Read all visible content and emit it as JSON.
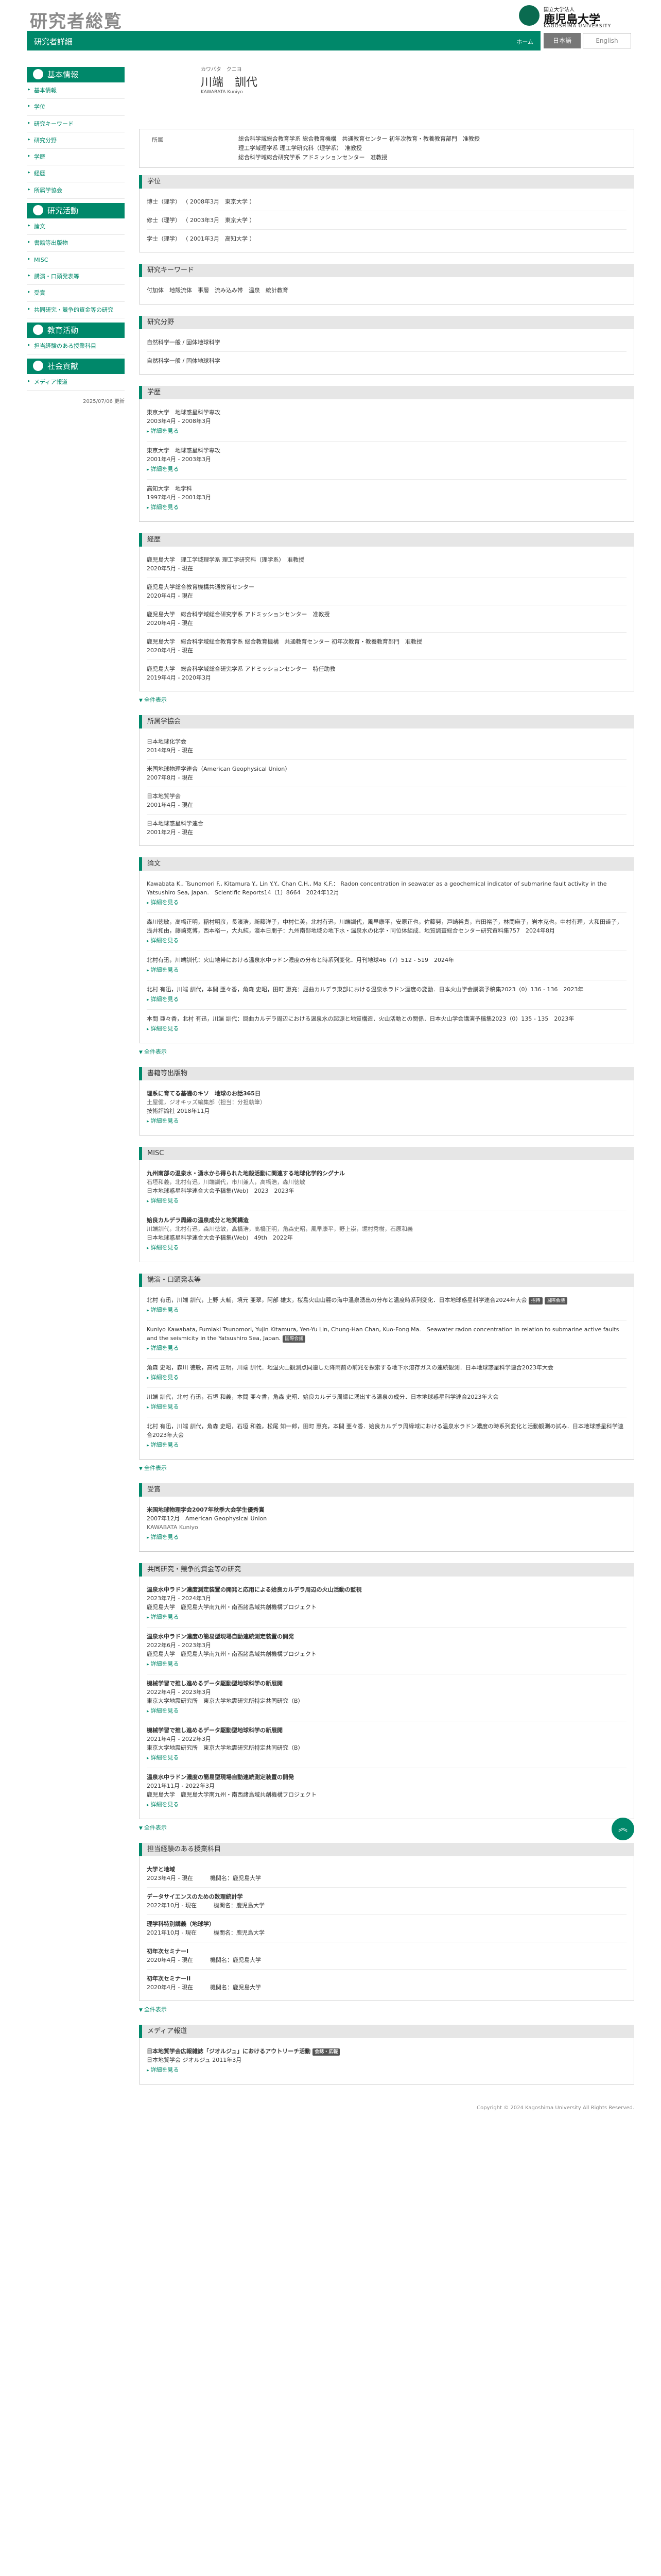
{
  "header": {
    "site_title": "研究者総覧",
    "subbar_label": "研究者詳細",
    "home_link": "ホーム",
    "lang_ja": "日本語",
    "lang_en": "English",
    "logo_sub": "国立大学法人",
    "logo_name": "鹿児島大学",
    "logo_en": "KAGOSHIMA UNIVERSITY"
  },
  "sidebar": {
    "basic_head": "基本情報",
    "basic_items": [
      "基本情報",
      "学位",
      "研究キーワード",
      "研究分野",
      "学歴",
      "経歴",
      "所属学協会"
    ],
    "research_head": "研究活動",
    "research_items": [
      "論文",
      "書籍等出版物",
      "MISC",
      "講演・口頭発表等",
      "受賞",
      "共同研究・競争的資金等の研究"
    ],
    "education_head": "教育活動",
    "education_items": [
      "担当経験のある授業科目"
    ],
    "social_head": "社会貢献",
    "social_items": [
      "メディア報道"
    ],
    "date": "2025/07/06 更新"
  },
  "profile": {
    "kana": "カワバタ　クニヨ",
    "name": "川端　訓代",
    "romaji": "KAWABATA Kuniyo",
    "aff_label": "所属",
    "aff_lines": [
      "総合科学域総合教育学系 総合教育機構　共通教育センター 初年次教育・教養教育部門　准教授",
      "理工学域理学系 理工学研究科（理学系）　准教授",
      "総合科学域総合研究学系 アドミッションセンター　准教授"
    ]
  },
  "degrees": {
    "head": "学位",
    "items": [
      "博士（理学） （ 2008年3月　東京大学 ）",
      "修士（理学） （ 2003年3月　東京大学 ）",
      "学士（理学） （ 2001年3月　高知大学 ）"
    ]
  },
  "keywords": {
    "head": "研究キーワード",
    "text": "付加体　地殻流体　事層　流み込み帯　温泉　統計教育"
  },
  "fields": {
    "head": "研究分野",
    "items": [
      "自然科学一般 / 固体地球科学",
      "自然科学一般 / 固体地球科学"
    ]
  },
  "education": {
    "head": "学歴",
    "more": "詳細を見る",
    "items": [
      {
        "name": "東京大学　地球惑星科学専攻",
        "date": "2003年4月 - 2008年3月"
      },
      {
        "name": "東京大学　地球惑星科学専攻",
        "date": "2001年4月 - 2003年3月"
      },
      {
        "name": "高知大学　地学科",
        "date": "1997年4月 - 2001年3月"
      }
    ]
  },
  "career": {
    "head": "経歴",
    "showall": "全件表示",
    "items": [
      {
        "name": "鹿児島大学　理工学域理学系 理工学研究科（理学系）　准教授",
        "date": "2020年5月 - 現在"
      },
      {
        "name": "鹿児島大学総合教育機構共通教育センター",
        "date": "2020年4月 - 現在"
      },
      {
        "name": "鹿児島大学　総合科学域総合研究学系 アドミッションセンター　准教授",
        "date": "2020年4月 - 現在"
      },
      {
        "name": "鹿児島大学　総合科学域総合教育学系 総合教育機構　共通教育センター 初年次教育・教養教育部門　准教授",
        "date": "2020年4月 - 現在"
      },
      {
        "name": "鹿児島大学　総合科学域総合研究学系 アドミッションセンター　特任助教",
        "date": "2019年4月 - 2020年3月"
      }
    ]
  },
  "societies": {
    "head": "所属学協会",
    "items": [
      {
        "name": "日本地球化学会",
        "date": "2014年9月 - 現在"
      },
      {
        "name": "米国地球物理学連合（American Geophysical Union）",
        "date": "2007年8月 - 現在"
      },
      {
        "name": "日本地質学会",
        "date": "2001年4月 - 現在"
      },
      {
        "name": "日本地球惑星科学連合",
        "date": "2001年2月 - 現在"
      }
    ]
  },
  "papers": {
    "head": "論文",
    "more": "詳細を見る",
    "showall": "全件表示",
    "items": [
      {
        "text": "Kawabata K., Tsunomori F., Kitamura Y., Lin Y.Y., Chan C.H., Ma K.F.： Radon concentration in seawater as a geochemical indicator of submarine fault activity in the Yatsushiro Sea, Japan.　Scientific Reports14（1）8664　2024年12月"
      },
      {
        "text": "森川徳敏，高橋正明，稲村明彦，長濱浩，新藤洋子，中村仁美，北村有迅，川端訓代，風早康平，安原正也，佐藤努，戸崎裕貴，市田裕子，林間麻子，岩本克也，中村有理，大和田道子，浅井和由，藤崎克博，西本裕一，大丸純，濱本日朋子：九州南部地域の地下水・温泉水の化学・同位体組成．地質調査総合センター研究資料集757　2024年8月"
      },
      {
        "text": "北村有迅，川端訓代：火山地帯における温泉水中ラドン濃度の分布と時系列変化．月刊地球46（7）512 - 519　2024年"
      },
      {
        "text": "北村 有迅，川端 訓代，本間 亜々香，角森 史昭，田町 惠充：屈曲カルデラ東部における温泉水ラドン濃度の変動．日本火山学会講演予稿集2023（0）136 - 136　2023年"
      },
      {
        "text": "本間 亜々香，北村 有迅，川端 訓代：屈曲カルデラ周辺における温泉水の起源と地質構造．火山活動との関係．日本火山学会講演予稿集2023（0）135 - 135　2023年"
      }
    ]
  },
  "books": {
    "head": "書籍等出版物",
    "more": "詳細を見る",
    "items": [
      {
        "title": "理系に育てる基礎のキソ　地球のお話365日",
        "auth": "土屋健，ジオキッズ編集部（担当：分担執筆）",
        "date": "技術評論社 2018年11月"
      }
    ]
  },
  "misc": {
    "head": "MISC",
    "more": "詳細を見る",
    "items": [
      {
        "title": "九州南部の温泉水・湧水から得られた地殻活動に関連する地球化学的シグナル",
        "auth": "石垣和義，北村有迅，川端訓代，市川兼人，高橋浩，森川徳敏",
        "date": "日本地球惑星科学連合大会予稿集(Web)　2023　2023年"
      },
      {
        "title": "姶良カルデラ周縁の温泉成分と地質構造",
        "auth": "川端訓代，北村有迅，森川徳敏，高橋浩，高橋正明，角森史昭，風早康平，野上崇，堀村秀樹，石原和義",
        "date": "日本地球惑星科学連合大会予稿集(Web)　49th　2022年"
      }
    ]
  },
  "talks": {
    "head": "講演・口頭発表等",
    "more": "詳細を見る",
    "showall": "全件表示",
    "badge_invited": "招待",
    "badge_intl": "国際会議",
    "items": [
      {
        "text": "北村 有迅，川端 訓代，上野 大輔，境元 亜翠，阿部 雄太，桜島火山山麓の海中温泉湧出の分布と温度時系列変化．日本地球惑星科学連合2024年大会",
        "badges": [
          "招待",
          "国際会議"
        ]
      },
      {
        "text": "Kuniyo Kawabata, Fumiaki Tsunomori, Yujin Kitamura, Yen-Yu Lin, Chung-Han Chan, Kuo-Fong Ma.　Seawater radon concentration in relation to submarine active faults and the seismicity in the Yatsushiro Sea, Japan.",
        "badges": [
          "国際会議"
        ]
      },
      {
        "text": "角森 史昭，森川 徳敏，高橋 正明，川端 訓代．地温火山観測点同連した降雨前の前兆を探索する地下水溶存ガスの連続観測．日本地球惑星科学連合2023年大会",
        "badges": []
      },
      {
        "text": "川端 訓代，北村 有迅，石垣 和義，本間 亜々香，角森 史昭．姶良カルデラ周縁に湧出する温泉の成分．日本地球惑星科学連合2023年大会",
        "badges": []
      },
      {
        "text": "北村 有迅，川端 訓代，角森 史昭，石垣 和義，松尾 知一郎，田町 惠充，本間 亜々香．姶良カルデラ周縁域における温泉水ラドン濃度の時系列変化と活動観測の試み．日本地球惑星科学連合2023年大会",
        "badges": []
      }
    ]
  },
  "awards": {
    "head": "受賞",
    "more": "詳細を見る",
    "items": [
      {
        "title": "米国地球物理学会2007年秋季大会学生優秀賞",
        "date": "2007年12月　American Geophysical Union",
        "auth": "KAWABATA Kuniyo"
      }
    ]
  },
  "grants": {
    "head": "共同研究・競争的資金等の研究",
    "more": "詳細を見る",
    "showall": "全件表示",
    "items": [
      {
        "title": "温泉水中ラドン濃度測定装置の開発と応用による姶良カルデラ周辺の火山活動の監視",
        "date": "2023年7月 - 2024年3月",
        "org": "鹿児島大学　鹿児島大学南九州・南西諸島域共創機構プロジェクト"
      },
      {
        "title": "温泉水中ラドン濃度の簡易型現場自動連続測定装置の開発",
        "date": "2022年6月 - 2023年3月",
        "org": "鹿児島大学　鹿児島大学南九州・南西諸島域共創機構プロジェクト"
      },
      {
        "title": "機械学習で推し進めるデータ駆動型地球科学の新展開",
        "date": "2022年4月 - 2023年3月",
        "org": "東京大学地震研究所　東京大学地震研究所特定共同研究（B）"
      },
      {
        "title": "機械学習で推し進めるデータ駆動型地球科学の新展開",
        "date": "2021年4月 - 2022年3月",
        "org": "東京大学地震研究所　東京大学地震研究所特定共同研究（B）"
      },
      {
        "title": "温泉水中ラドン濃度の簡易型現場自動連続測定装置の開発",
        "date": "2021年11月 - 2022年3月",
        "org": "鹿児島大学　鹿児島大学南九州・南西諸島域共創機構プロジェクト"
      }
    ]
  },
  "courses": {
    "head": "担当経験のある授業科目",
    "showall": "全件表示",
    "items": [
      {
        "title": "大学と地域",
        "date": "2023年4月 - 現在",
        "org": "機関名：鹿児島大学"
      },
      {
        "title": "データサイエンスのための数理統計学",
        "date": "2022年10月 - 現在",
        "org": "機関名：鹿児島大学"
      },
      {
        "title": "理学科特別講義（地球学）",
        "date": "2021年10月 - 現在",
        "org": "機関名：鹿児島大学"
      },
      {
        "title": "初年次セミナーI",
        "date": "2020年4月 - 現在",
        "org": "機関名：鹿児島大学"
      },
      {
        "title": "初年次セミナーII",
        "date": "2020年4月 - 現在",
        "org": "機関名：鹿児島大学"
      }
    ]
  },
  "media": {
    "head": "メディア報道",
    "items": [
      {
        "title": "日本地質学会広報雑誌「ジオルジュ」におけるアウトリーチ活動",
        "date": "日本地質学会 ジオルジュ 2011年3月",
        "badge": "会誌・広報"
      }
    ],
    "more": "詳細を見る"
  },
  "footer": "Copyright © 2024 Kagoshima University All Rights Reserved.",
  "pagetop": "︽"
}
